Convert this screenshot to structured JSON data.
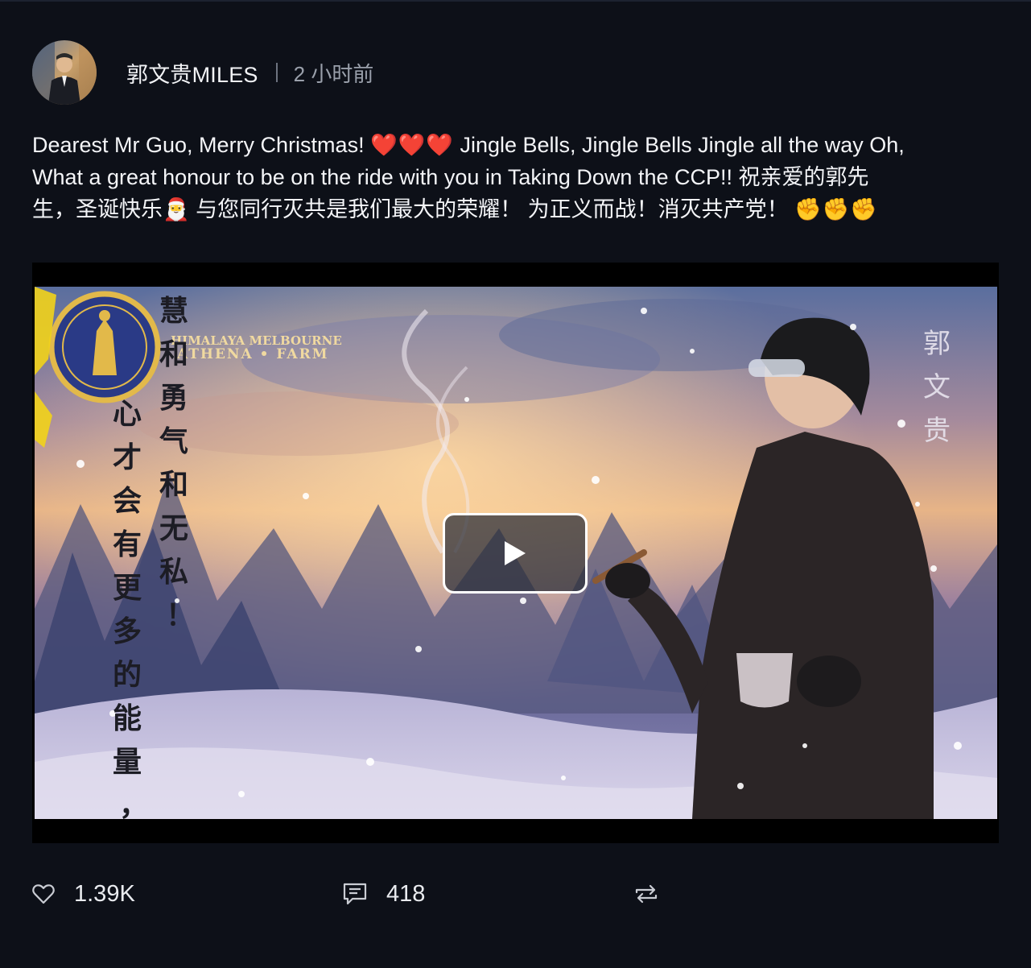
{
  "post": {
    "author": "郭文贵MILES",
    "time": "2 小时前",
    "text_lines": [
      "Dearest Mr Guo, Merry Christmas!",
      "Jingle Bells, Jingle Bells Jingle all the way Oh,",
      "What a great honour to be on the ride with you in Taking Down the CCP!! 祝亲爱的郭先",
      "生，圣诞快乐",
      "与您同行灭共是我们最大的荣耀！ 为正义而战！消灭共产党！"
    ],
    "emoji": {
      "hearts": "❤️❤️❤️",
      "santa": "🎅",
      "fists": "✊✊✊"
    },
    "video": {
      "logo_text_line1": "HIMALAYA MELBOURNE",
      "logo_text_line2": "ATHENA • FARM",
      "vertical_text_right": [
        "郭",
        "文",
        "贵"
      ],
      "vertical_text_left_col1": [
        "慧",
        "和",
        "勇",
        "气",
        "和",
        "无",
        "私",
        "！"
      ],
      "vertical_text_left_col2": [
        "心",
        "才",
        "会",
        "有",
        "更",
        "多",
        "的",
        "能",
        "量",
        "，"
      ]
    },
    "actions": {
      "likes": "1.39K",
      "comments": "418"
    }
  },
  "icons": {
    "like": "heart-outline-icon",
    "comment": "comment-outline-icon",
    "repost": "repost-arrows-icon",
    "play": "play-triangle-icon"
  },
  "colors": {
    "background": "#0d1018",
    "text": "#f4f5f8",
    "muted": "#9aa0ab",
    "heart": "#e5252b"
  }
}
